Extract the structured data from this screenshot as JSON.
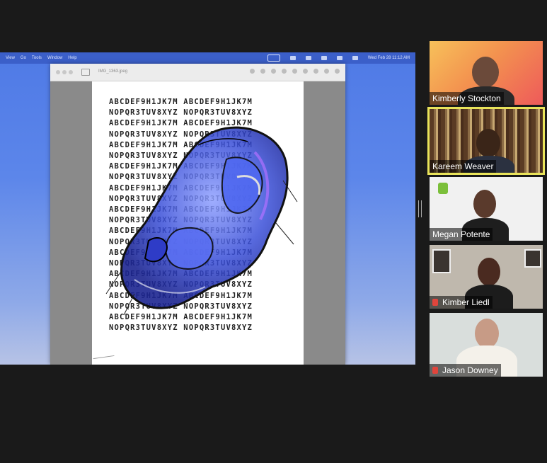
{
  "menubar": {
    "items": [
      "View",
      "Go",
      "Tools",
      "Window",
      "Help"
    ],
    "clock": "Wed Feb 28  11:12 AM"
  },
  "preview": {
    "filename": "IMG_1363.jpeg",
    "letter_rows": [
      "ABCDEF9H1JK7M ABCDEF9H1JK7M",
      "NOPQR3TUV8XYZ NOPQR3TUV8XYZ",
      "ABCDEF9H1JK7M ABCDEF9H1JK7M",
      "NOPQR3TUV8XYZ NOPQR3TUV8XYZ",
      "ABCDEF9H1JK7M ABCDEF9H1JK7M",
      "NOPQR3TUV8XYZ NOPQR3TUV8XYZ",
      "ABCDEF9H1JK7M ABCDEF9H1JK7M",
      "NOPQR3TUV8XYZ NOPQR3TUV8XYZ",
      "ABCDEF9H1JK7M ABCDEF9H1JK7M",
      "NOPQR3TUV8XYZ NOPQR3TUV8XYZ",
      "ABCDEF9H1JK7M ABCDEF9H1JK7M",
      "NOPQR3TUV8XYZ NOPQR3TUV8XYZ",
      "ABCDEF9H1JK7M ABCDEF9H1JK7M",
      "NOPQR3TUV8XYZ NOPQR3TUV8XYZ",
      "ABCDEF9H1JK7M ABCDEF9H1JK7M",
      "NOPQR3TUV8XYZ NOPQR3TUV8XYZ",
      "ABCDEF9H1JK7M ABCDEF9H1JK7M",
      "NOPQR3TUV8XYZ NOPQR3TUV8XYZ",
      "ABCDEF9H1JK7M ABCDEF9H1JK7M",
      "NOPQR3TUV8XYZ NOPQR3TUV8XYZ",
      "ABCDEF9H1JK7M ABCDEF9H1JK7M",
      "NOPQR3TUV8XYZ NOPQR3TUV8XYZ"
    ]
  },
  "participants": [
    {
      "name": "Kimberly Stockton",
      "muted": false,
      "active": false
    },
    {
      "name": "Kareem Weaver",
      "muted": false,
      "active": true
    },
    {
      "name": "Megan Potente",
      "muted": false,
      "active": false
    },
    {
      "name": "Kimber Liedl",
      "muted": true,
      "active": false
    },
    {
      "name": "Jason Downey",
      "muted": true,
      "active": false
    }
  ],
  "colors": {
    "active_speaker_outline": "#e9e45a",
    "muted_icon": "#e0453c",
    "art_blue": "#3a4fd8"
  }
}
